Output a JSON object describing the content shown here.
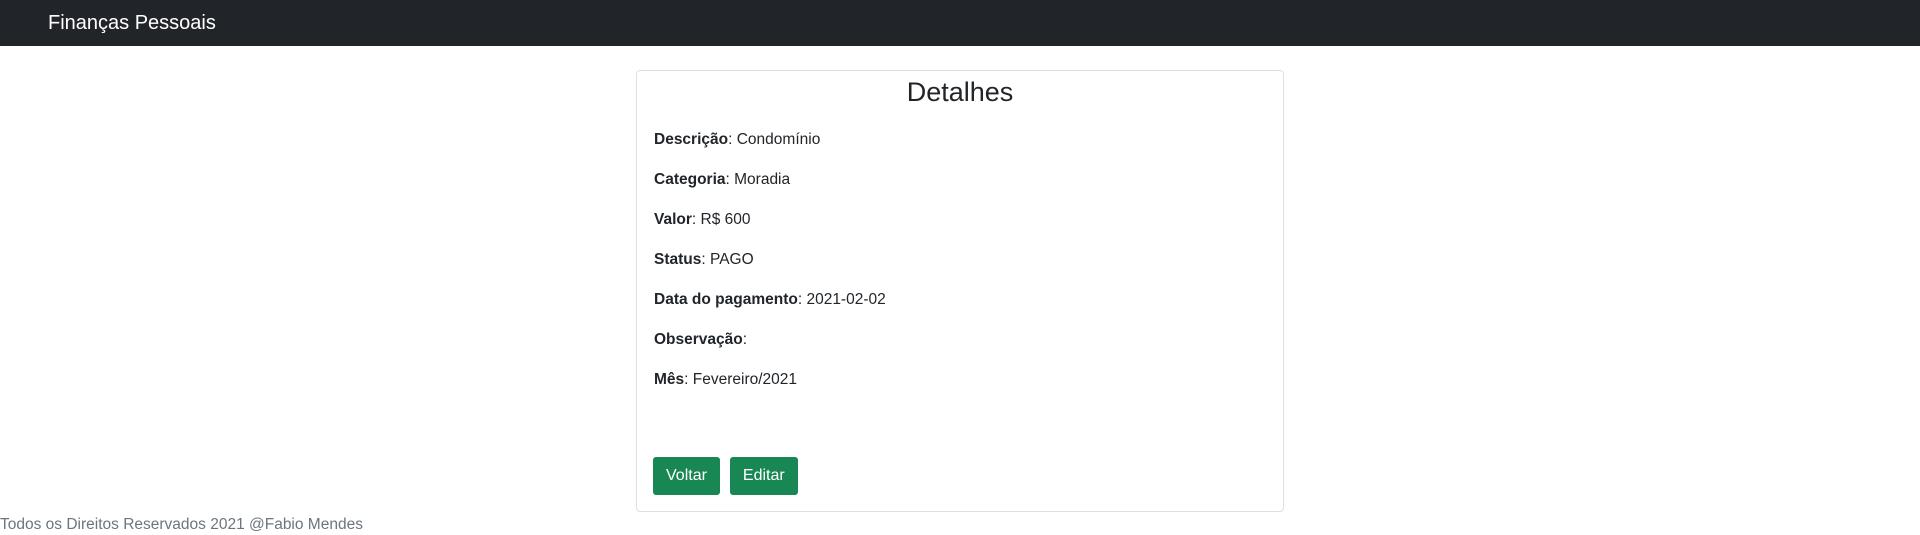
{
  "navbar": {
    "brand": "Finanças Pessoais"
  },
  "card": {
    "title": "Detalhes",
    "fields": [
      {
        "label": "Descrição",
        "value": "Condomínio"
      },
      {
        "label": "Categoria",
        "value": "Moradia"
      },
      {
        "label": "Valor",
        "value": "R$ 600"
      },
      {
        "label": "Status",
        "value": "PAGO"
      },
      {
        "label": "Data do pagamento",
        "value": "2021-02-02"
      },
      {
        "label": "Observação",
        "value": ""
      },
      {
        "label": "Mês",
        "value": "Fevereiro/2021"
      }
    ],
    "buttons": {
      "back_label": "Voltar",
      "edit_label": "Editar"
    }
  },
  "footer": {
    "text": "Todos os Direitos Reservados 2021 @Fabio Mendes"
  },
  "colors": {
    "navbar_bg": "#212529",
    "button_bg": "#198754",
    "footer_text": "#6c757d"
  }
}
